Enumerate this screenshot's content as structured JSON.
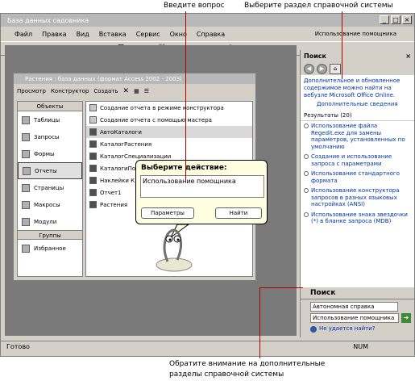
{
  "annotations": {
    "top_left": "Введите вопрос",
    "top_right": "Выберите раздел справочной системы",
    "bottom_line1": "Обратите внимание на дополнительные",
    "bottom_line2": "разделы справочной системы"
  },
  "app": {
    "title": "База данных садовника",
    "menu": [
      "Файл",
      "Правка",
      "Вид",
      "Вставка",
      "Сервис",
      "Окно",
      "Справка"
    ],
    "help_box": "Использование помощника"
  },
  "db_window": {
    "title": "Растения : база данных (формат Access 2002 - 2003)",
    "toolbar": {
      "preview": "Просмотр",
      "designer": "Конструктор",
      "create": "Создать"
    },
    "objects_header": "Объекты",
    "objects": [
      "Таблицы",
      "Запросы",
      "Формы",
      "Отчеты",
      "Страницы",
      "Макросы",
      "Модули"
    ],
    "groups_header": "Группы",
    "groups": [
      "Избранное"
    ],
    "items": [
      "Создание отчета в режиме конструктора",
      "Создание отчета с помощью мастера",
      "АвтоКаталоги",
      "КаталогРастения",
      "КаталогСпециализации",
      "КаталогиПо…",
      "Наклейки К…",
      "Отчет1",
      "Растения"
    ]
  },
  "assistant": {
    "prompt": "Выберите действие:",
    "query": "Использование помощника",
    "options_btn": "Параметры",
    "search_btn": "Найти"
  },
  "task_pane": {
    "title": "Поиск",
    "intro": "Дополнительное и обновленное содержимое можно найти на вебузле Microsoft Office Online.",
    "more_link": "Дополнительные сведения",
    "results_label": "Результаты (20)",
    "results": [
      "Использование файла Regedit.exe для замены параметров, установленных по умолчанию",
      "Создание и использование запроса с параметрами",
      "Использование стандартного формата",
      "Использование конструктора запросов в разных языковых настройках (ANSI)",
      "Использование знака звездочки (*) в бланке запроса (MDB)"
    ],
    "search_header": "Поиск",
    "search_scope": "Автономная справка",
    "search_text": "Использование помощника",
    "not_found": "Не удается найти?"
  },
  "statusbar": {
    "left": "Готово",
    "right": "NUM"
  }
}
